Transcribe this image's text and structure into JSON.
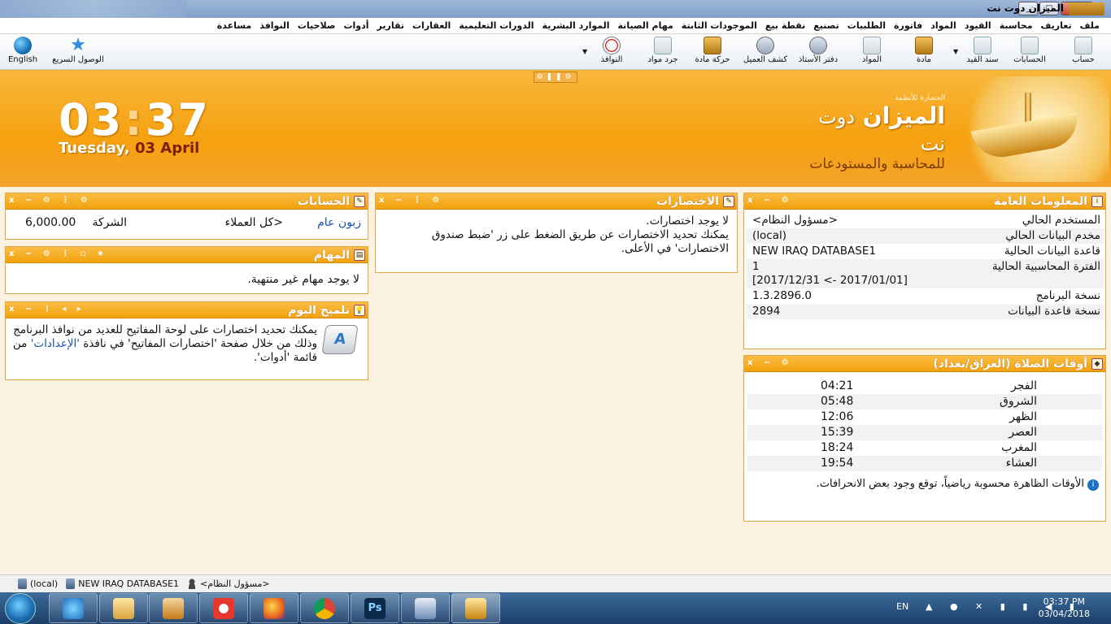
{
  "window": {
    "title": "الميزان دوت نت",
    "controls": [
      "_",
      "□",
      "x"
    ]
  },
  "menu": [
    "ملف",
    "تعاريف",
    "محاسبة",
    "القيود",
    "المواد",
    "فاتورة",
    "الطلبيات",
    "تصنيع",
    "نقطة بيع",
    "الموجودات الثابتة",
    "مهام الصيانة",
    "الموارد البشرية",
    "الدورات التعليمية",
    "العقارات",
    "تقارير",
    "أدوات",
    "صلاحيات",
    "النوافذ",
    "مساعدة"
  ],
  "toolbar": {
    "items": [
      "حساب",
      "الحسابات",
      "سند القيد",
      "مادة",
      "المواد",
      "دفتر الأستاذ",
      "كشف العميل",
      "حركة مادة",
      "جرد مواد",
      "النوافذ"
    ],
    "quick_access": "الوصول السريع",
    "language": "English"
  },
  "banner": {
    "hour": "03",
    "minute": "37",
    "day": "Tuesday,",
    "date": "03 April",
    "brand_small": "الحضارة للأنظمة",
    "brand_name": "الميزان",
    "brand_suffix": "دوت نت",
    "brand_sub": "للمحاسبة والمستودعات"
  },
  "general_info": {
    "title": "المعلومات العامة",
    "rows": [
      {
        "k": "المستخدم الحالي",
        "v": "<مسؤول النظام>"
      },
      {
        "k": "مخدم البيانات الحالي",
        "v": "(local)"
      },
      {
        "k": "قاعدة البيانات الحالية",
        "v": "NEW IRAQ DATABASE1"
      },
      {
        "k": "الفترة المحاسبية الحالية",
        "v": "1",
        "v2": "[2017/12/31 <- 2017/01/01]"
      },
      {
        "k": "نسخة البرنامج",
        "v": "1.3.2896.0"
      },
      {
        "k": "نسخة قاعدة البيانات",
        "v": "2894"
      }
    ]
  },
  "prayer": {
    "title": "أوقات الصلاة (العراق/بغداد)",
    "rows": [
      {
        "k": "الفجر",
        "v": "04:21"
      },
      {
        "k": "الشروق",
        "v": "05:48"
      },
      {
        "k": "الظهر",
        "v": "12:06"
      },
      {
        "k": "العصر",
        "v": "15:39"
      },
      {
        "k": "المغرب",
        "v": "18:24"
      },
      {
        "k": "العشاء",
        "v": "19:54"
      }
    ],
    "note": "الأوقات الظاهرة محسوبة رياضياً، توقع وجود بعض الانحرافات."
  },
  "shortcuts": {
    "title": "الاختصارات",
    "line1": "لا يوجد اختصارات.",
    "line2": "يمكنك تحديد الاختصارات عن طريق الضغط على زر 'ضبط صندوق الاختصارات' في الأعلى."
  },
  "accounts": {
    "title": "الحسابات",
    "label": "زبون عام",
    "company": "الشركة",
    "group": "<كل العملاء",
    "amount": "6,000.00"
  },
  "tasks": {
    "title": "المهام",
    "empty": "لا يوجد مهام غير منتهية."
  },
  "tip": {
    "title": "تلميح اليوم",
    "text1": "يمكنك تحديد اختصارات على لوحة المفاتيح للعديد من نوافذ البرنامج وذلك من خلال صفحة 'اختصارات المفاتيح' في نافذة",
    "link": "'الإعدادات'",
    "text2": "من قائمة 'أدوات'."
  },
  "statusbar": {
    "server": "(local)",
    "database": "NEW IRAQ DATABASE1",
    "user": "<مسؤول النظام>"
  },
  "taskbar": {
    "lang": "EN",
    "time": "03:37 PM",
    "date": "03/04/2018"
  }
}
